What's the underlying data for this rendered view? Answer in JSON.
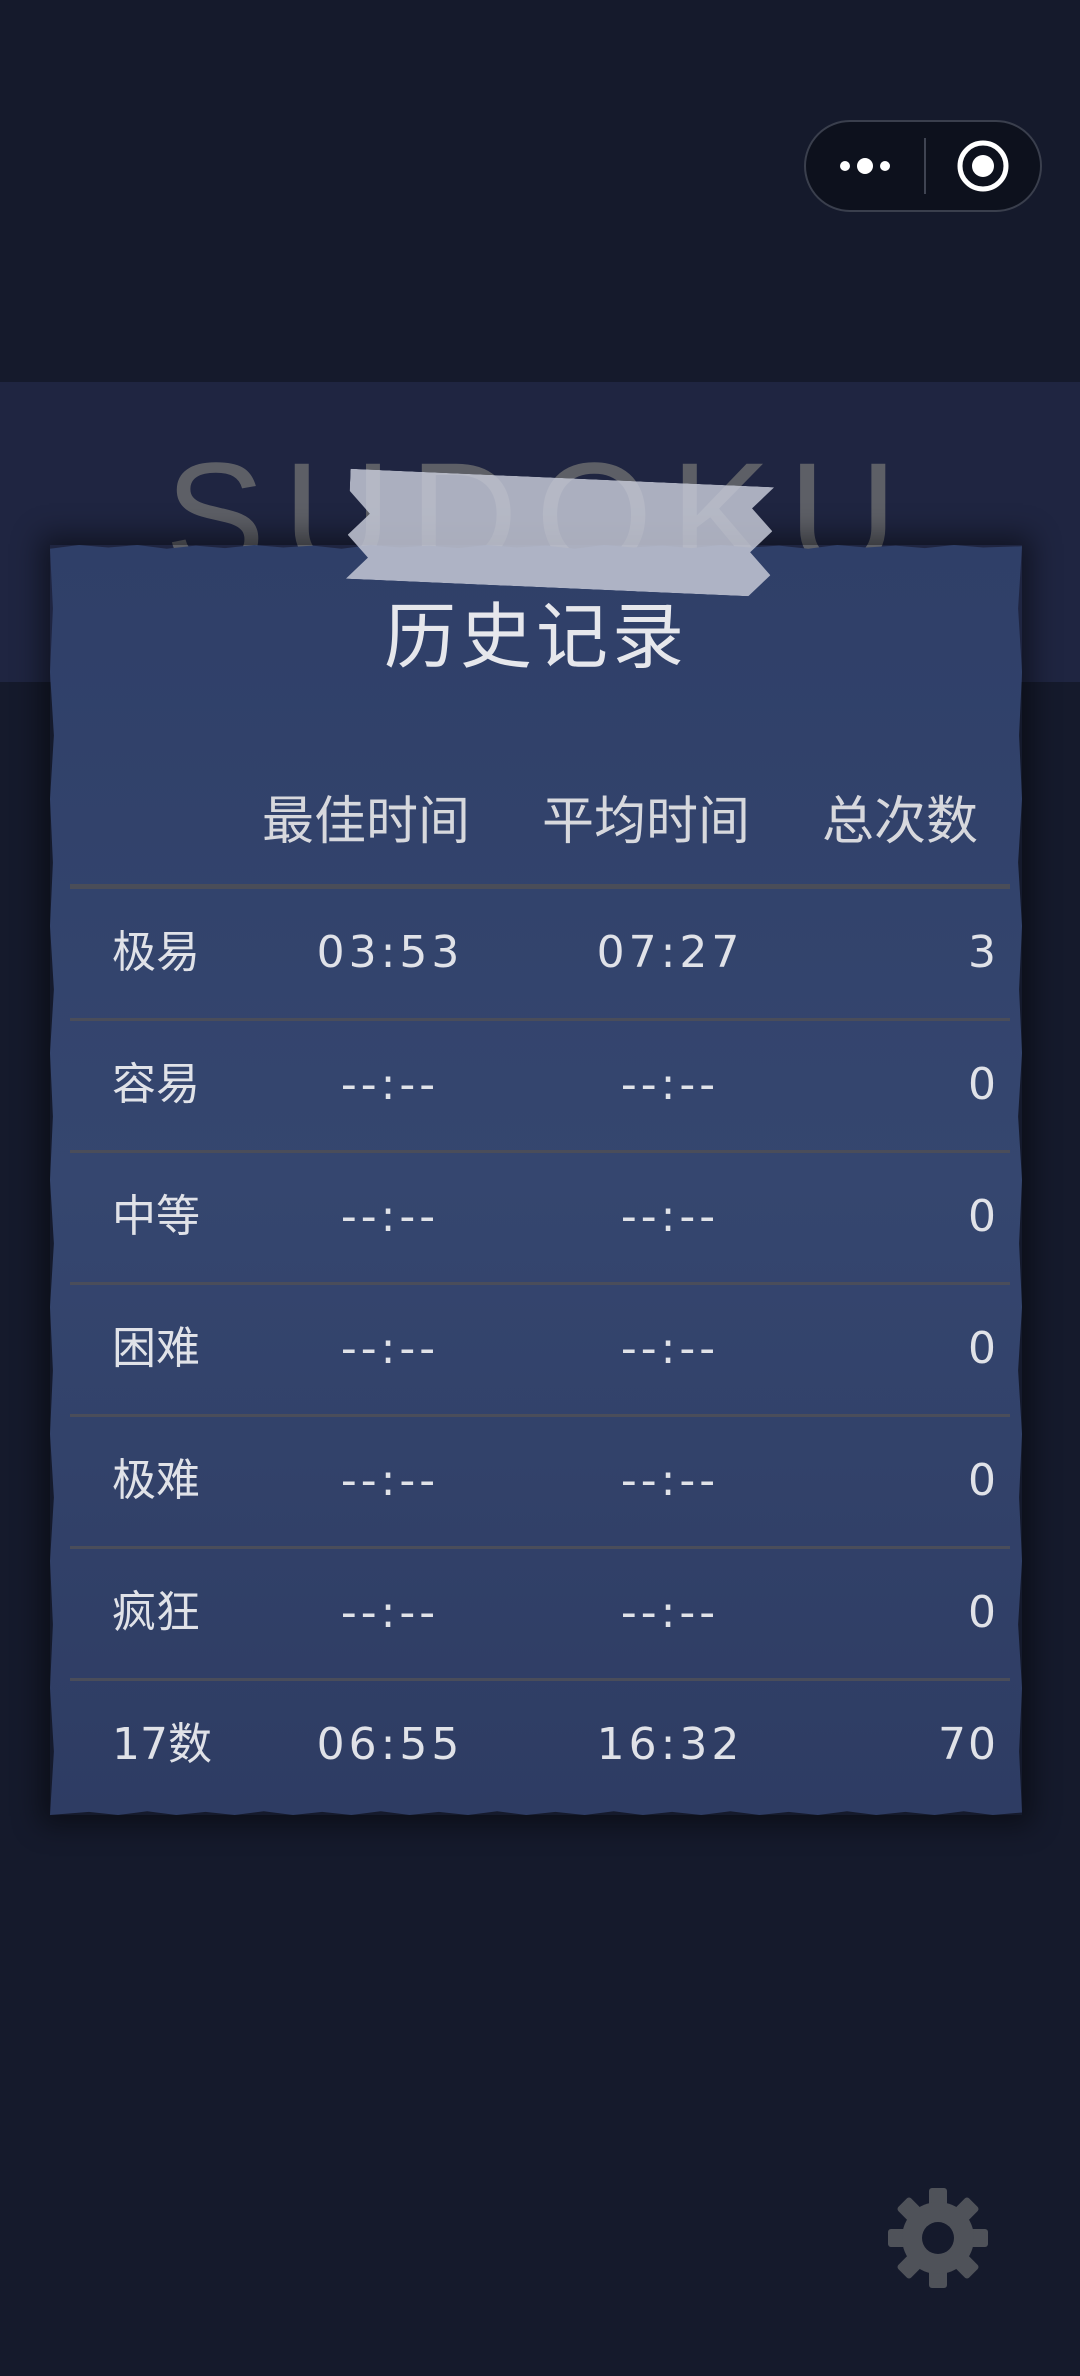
{
  "capsule": {
    "more_icon": "more-dots-icon",
    "close_icon": "target-circle-icon"
  },
  "banner": {
    "title": "SUDOKU"
  },
  "record": {
    "title": "历史记录",
    "columns": [
      "最佳时间",
      "平均时间",
      "总次数"
    ],
    "rows": [
      {
        "level": "极易",
        "best": "03:53",
        "average": "07:27",
        "count": "3"
      },
      {
        "level": "容易",
        "best": "--:--",
        "average": "--:--",
        "count": "0"
      },
      {
        "level": "中等",
        "best": "--:--",
        "average": "--:--",
        "count": "0"
      },
      {
        "level": "困难",
        "best": "--:--",
        "average": "--:--",
        "count": "0"
      },
      {
        "level": "极难",
        "best": "--:--",
        "average": "--:--",
        "count": "0"
      },
      {
        "level": "疯狂",
        "best": "--:--",
        "average": "--:--",
        "count": "0"
      },
      {
        "level": "17数",
        "best": "06:55",
        "average": "16:32",
        "count": "70"
      }
    ]
  },
  "footer": {
    "settings_icon": "gear-icon"
  },
  "colors": {
    "background": "#151a2c",
    "banner": "#1f2541",
    "card": "#33436c",
    "text": "#e0e2e8",
    "gear": "#4f5259"
  }
}
